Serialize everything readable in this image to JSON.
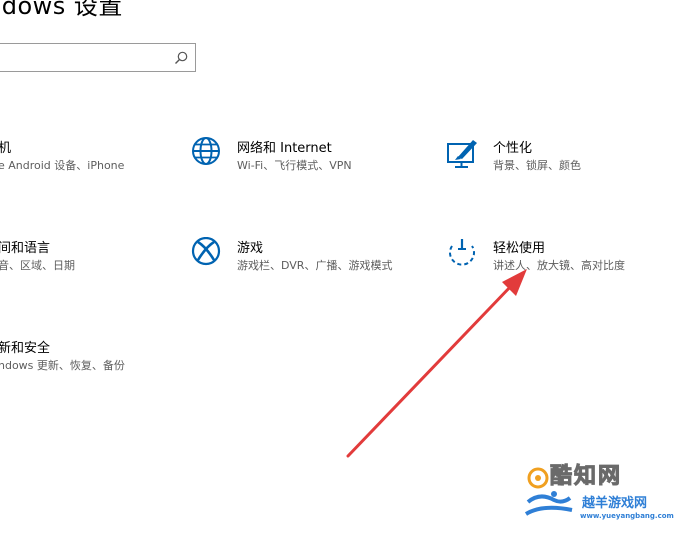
{
  "header": {
    "title": "ndows 设置"
  },
  "search": {
    "placeholder": ""
  },
  "tiles": [
    {
      "name": "机",
      "desc": "e Android 设备、iPhone"
    },
    {
      "name": "网络和 Internet",
      "desc": "Wi-Fi、飞行模式、VPN"
    },
    {
      "name": "个性化",
      "desc": "背景、锁屏、颜色"
    },
    {
      "name": "间和语言",
      "desc": "音、区域、日期"
    },
    {
      "name": "游戏",
      "desc": "游戏栏、DVR、广播、游戏模式"
    },
    {
      "name": "轻松使用",
      "desc": "讲述人、放大镜、高对比度"
    },
    {
      "name": "新和安全",
      "desc": "ndows 更新、恢复、备份"
    }
  ],
  "icons": {
    "search": "search-icon",
    "network": "globe-icon",
    "personalization": "paint-tablet-icon",
    "gaming": "xbox-icon",
    "ease_of_access": "ease-of-access-icon"
  },
  "annotation": {
    "arrow_color": "#e23b3b"
  },
  "watermark": {
    "line1": "酷知网",
    "line2": "越羊游戏网",
    "line3": "www.yueyangbang.com"
  },
  "colors": {
    "accent": "#0063b1",
    "text": "#000000",
    "subtext": "#5d5d5d"
  }
}
